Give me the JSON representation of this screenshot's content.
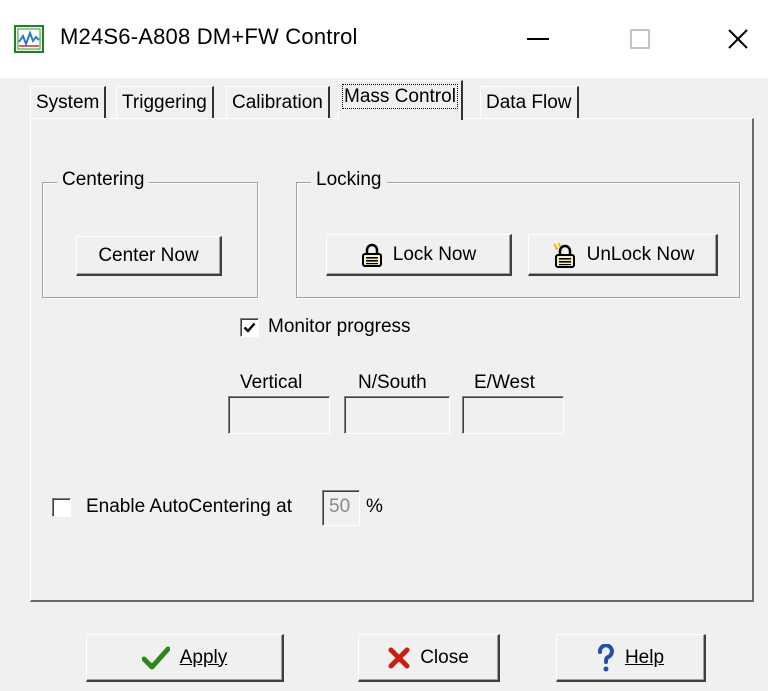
{
  "window": {
    "title": "M24S6-A808 DM+FW Control",
    "icon": "oscilloscope-app-icon",
    "controls": [
      "minimize-icon",
      "maximize-icon",
      "close-icon"
    ]
  },
  "tabs": [
    {
      "label": "System",
      "active": false
    },
    {
      "label": "Triggering",
      "active": false
    },
    {
      "label": "Calibration",
      "active": false
    },
    {
      "label": "Mass Control",
      "active": true
    },
    {
      "label": "Data Flow",
      "active": false
    }
  ],
  "centering": {
    "group_label": "Centering",
    "button_label": "Center Now"
  },
  "locking": {
    "group_label": "Locking",
    "lock_label": "Lock Now",
    "unlock_label": "UnLock Now",
    "lock_icon": "padlock-closed-icon",
    "unlock_icon": "padlock-open-icon"
  },
  "monitor": {
    "label": "Monitor progress",
    "checked": true,
    "fields": [
      {
        "label": "Vertical",
        "value": ""
      },
      {
        "label": "N/South",
        "value": ""
      },
      {
        "label": "E/West",
        "value": ""
      }
    ]
  },
  "autocenter": {
    "label": "Enable AutoCentering at",
    "checked": false,
    "value": "50",
    "unit": "%"
  },
  "footer": {
    "apply_label": "Apply",
    "close_label": "Close",
    "help_label": "Help",
    "apply_icon": "checkmark-icon",
    "close_icon": "x-cross-icon",
    "help_icon": "question-mark-icon"
  },
  "colors": {
    "apply_check": "#2a8a14",
    "close_x": "#c8200e",
    "help_q": "#1f4fb0",
    "face": "#f0f0f0"
  }
}
